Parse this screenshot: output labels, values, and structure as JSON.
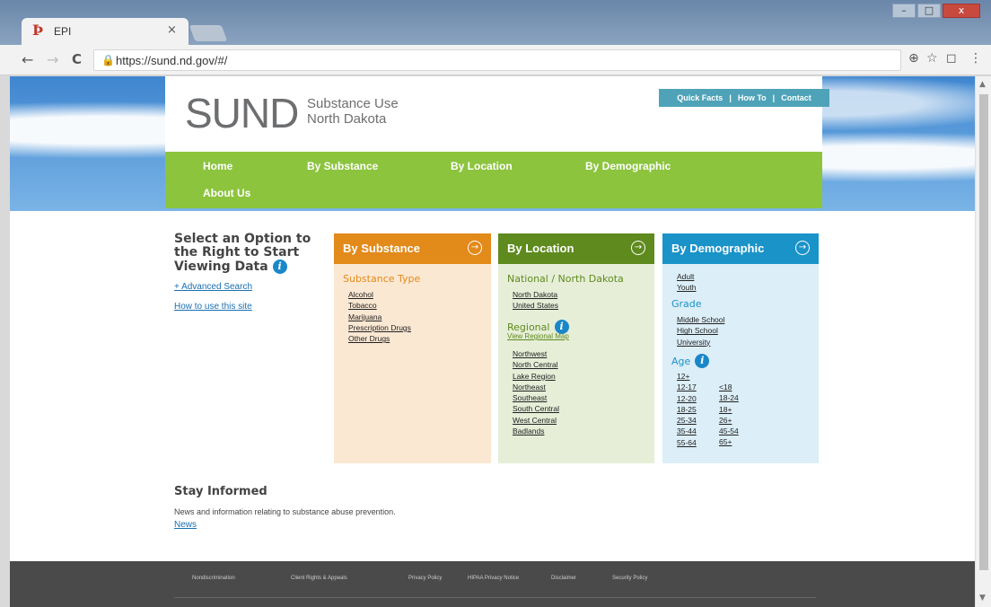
{
  "browser": {
    "tab_title": "EPI",
    "tab_favicon": "Þ",
    "tab_close": "×",
    "url": "https://sund.nd.gov/#/",
    "back_glyph": "←",
    "forward_glyph": "→",
    "reload_glyph": "C",
    "lock_glyph": "🔒",
    "zoom_glyph": "⊕",
    "star_glyph": "☆",
    "ext_glyph": "◻",
    "menu_glyph": "⋮",
    "win_min": "–",
    "win_max": "□",
    "win_close": "x"
  },
  "site": {
    "logo": "SUND",
    "logo_line1": "Substance Use",
    "logo_line2": "North Dakota",
    "quicklinks": [
      "Quick Facts",
      "|",
      "How To",
      "|",
      "Contact"
    ],
    "nav": [
      "Home",
      "By Substance",
      "By Location",
      "By Demographic",
      "About Us"
    ]
  },
  "intro": {
    "title": "Select an Option to the Right to Start Viewing Data",
    "info_glyph": "i",
    "advanced_search": "+ Advanced Search",
    "how_to": "How to use this site"
  },
  "panels": {
    "substance": {
      "heading": "By Substance",
      "arrow": "→",
      "color": "#e28a1a",
      "section": "Substance Type",
      "items": [
        "Alcohol",
        "Tobacco",
        "Marijuana",
        "Prescription Drugs",
        "Other Drugs"
      ]
    },
    "location": {
      "heading": "By Location",
      "arrow": "→",
      "color": "#5e8a1e",
      "section_national": "National / North Dakota",
      "national_items": [
        "North Dakota",
        "United States"
      ],
      "section_regional": "Regional",
      "regional_map": "View Regional Map",
      "regional_items": [
        "Northwest",
        "North Central",
        "Lake Region",
        "Northeast",
        "Southeast",
        "South Central",
        "West Central",
        "Badlands"
      ]
    },
    "demographic": {
      "heading": "By Demographic",
      "arrow": "→",
      "color": "#1a93c9",
      "age_groups": [
        "Adult",
        "Youth"
      ],
      "section_grade": "Grade",
      "grades": [
        "Middle School",
        "High School",
        "University"
      ],
      "section_age": "Age",
      "ages_left": [
        "12+",
        "12-17",
        "12-20",
        "18-25",
        "25-34",
        "35-44",
        "55-64"
      ],
      "ages_right": [
        "<18",
        "18-24",
        "18+",
        "26+",
        "45-54",
        "65+"
      ]
    }
  },
  "stay": {
    "title": "Stay Informed",
    "description": "News and information relating to substance abuse prevention.",
    "news": "News"
  },
  "footer": {
    "links": [
      "Nondiscrimination",
      "Client Rights & Appeals",
      "Privacy Policy",
      "HIPAA Privacy Notice",
      "Disclaimer",
      "Security Policy"
    ]
  }
}
